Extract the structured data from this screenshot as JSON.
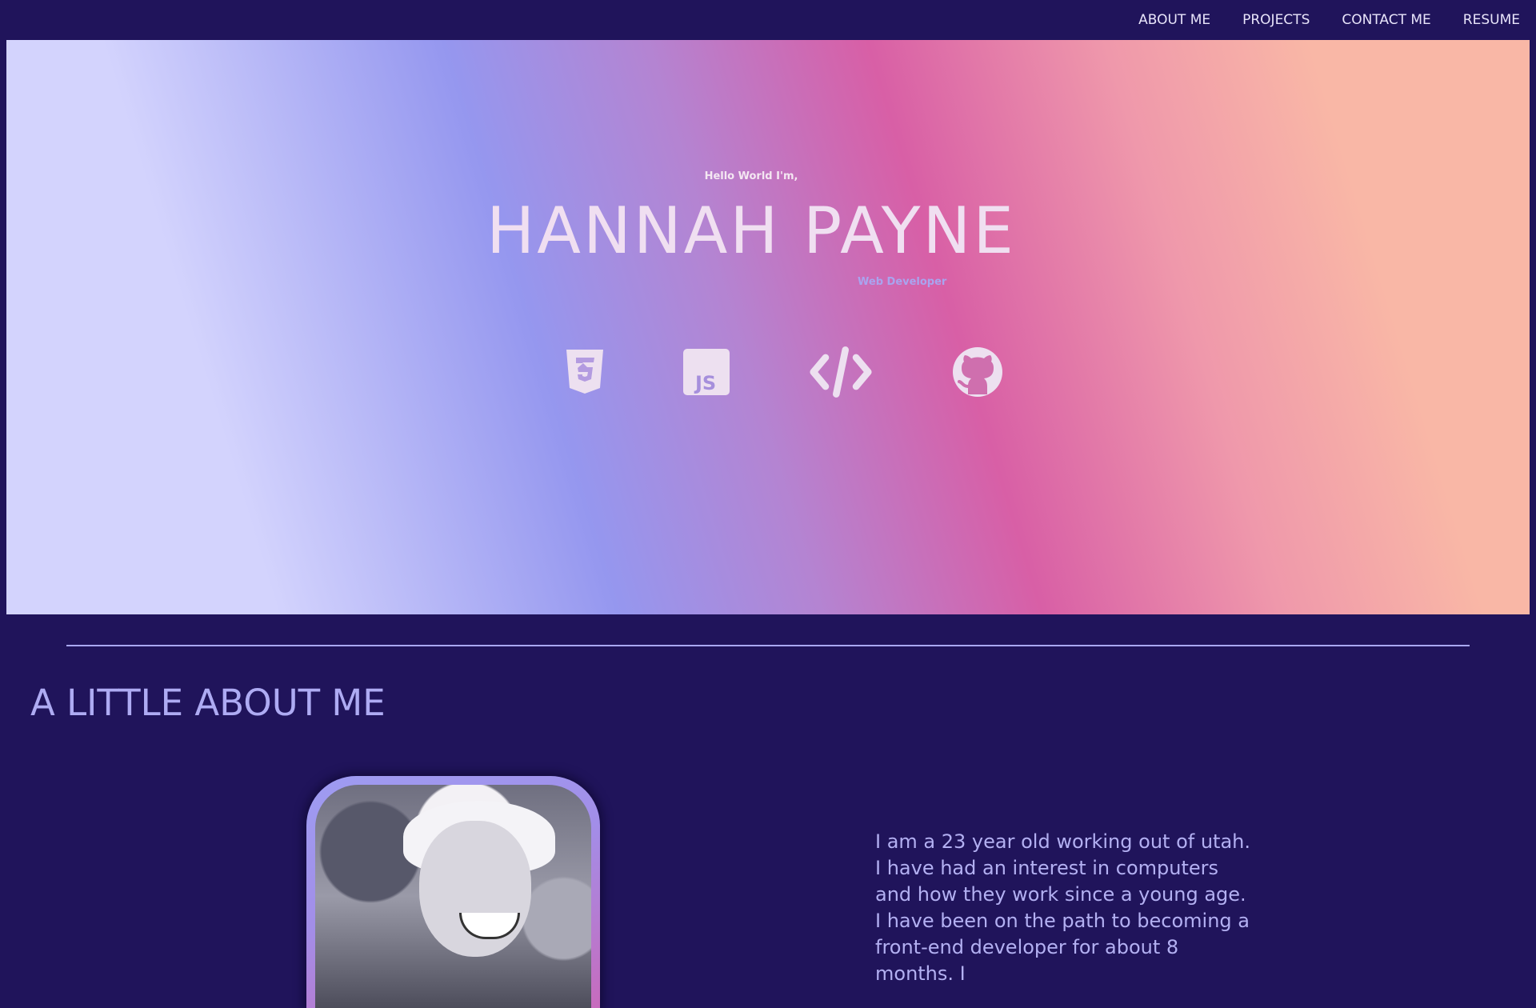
{
  "nav": {
    "items": [
      {
        "label": "ABOUT ME"
      },
      {
        "label": "PROJECTS"
      },
      {
        "label": "CONTACT ME"
      },
      {
        "label": "RESUME"
      }
    ]
  },
  "hero": {
    "greeting": "Hello World I'm,",
    "name": "HANNAH PAYNE",
    "role": "Web Developer",
    "icons": [
      "css3-icon",
      "javascript-icon",
      "code-icon",
      "github-icon"
    ]
  },
  "about": {
    "title": "A LITTLE ABOUT ME",
    "text": "I am a 23 year old working out of utah. I have had an interest in computers and how they work since a young age. I have been on the path to becoming a front-end developer for about 8 months. I"
  },
  "colors": {
    "background": "#20145b",
    "accent": "#aeabf3",
    "nav_text": "#e8e4fa"
  }
}
